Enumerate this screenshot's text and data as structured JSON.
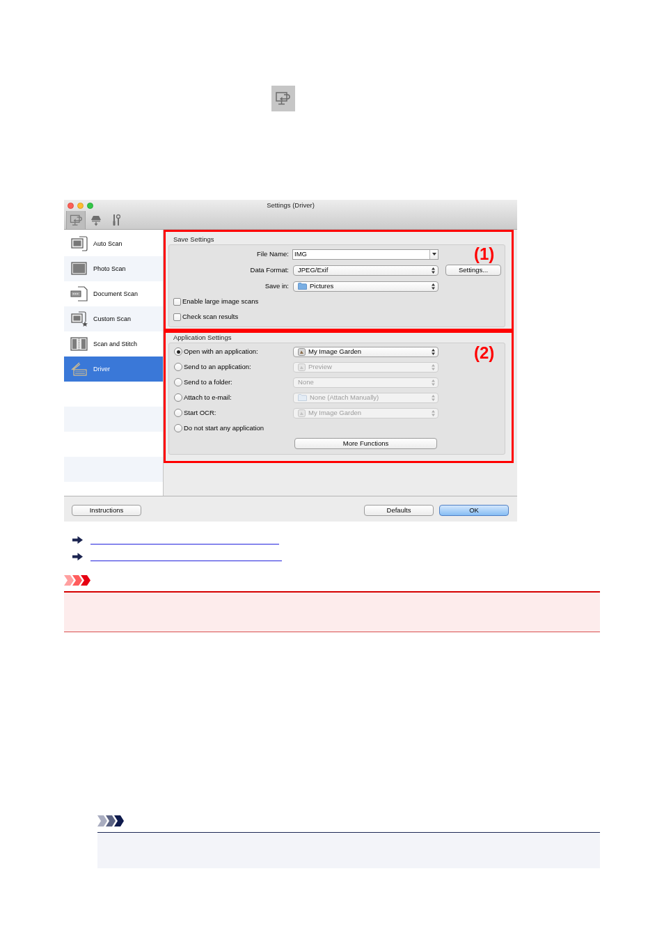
{
  "window": {
    "title": "Settings (Driver)"
  },
  "toolbar": [
    {
      "selected": true
    },
    {
      "selected": false
    },
    {
      "selected": false
    }
  ],
  "sidebar": {
    "items": [
      {
        "label": "Auto Scan",
        "selected": false
      },
      {
        "label": "Photo Scan",
        "selected": false
      },
      {
        "label": "Document Scan",
        "selected": false
      },
      {
        "label": "Custom Scan",
        "selected": false
      },
      {
        "label": "Scan and Stitch",
        "selected": false
      },
      {
        "label": "Driver",
        "selected": true
      }
    ]
  },
  "save_settings": {
    "title": "Save Settings",
    "callout": "(1)",
    "fields": [
      {
        "kind": "combo",
        "label": "File Name:",
        "value": "IMG"
      },
      {
        "kind": "popup",
        "label": "Data Format:",
        "value": "JPEG/Exif",
        "button": "Settings..."
      },
      {
        "kind": "folder",
        "label": "Save in:",
        "value": "Pictures"
      }
    ],
    "checkboxes": [
      {
        "label": "Enable large image scans",
        "checked": false
      },
      {
        "label": "Check scan results",
        "checked": false
      }
    ]
  },
  "application_settings": {
    "title": "Application Settings",
    "callout": "(2)",
    "options": [
      {
        "label": "Open with an application:",
        "selected": true,
        "dropdown": {
          "kind": "app",
          "value": "My Image Garden",
          "disabled": false
        }
      },
      {
        "label": "Send to an application:",
        "selected": false,
        "dropdown": {
          "kind": "app",
          "value": "Preview",
          "disabled": true
        }
      },
      {
        "label": "Send to a folder:",
        "selected": false,
        "dropdown": {
          "kind": "plain",
          "value": "None",
          "disabled": true
        }
      },
      {
        "label": "Attach to e-mail:",
        "selected": false,
        "dropdown": {
          "kind": "folder",
          "value": "None (Attach Manually)",
          "disabled": true
        }
      },
      {
        "label": "Start OCR:",
        "selected": false,
        "dropdown": {
          "kind": "app",
          "value": "My Image Garden",
          "disabled": true
        }
      },
      {
        "label": "Do not start any application",
        "selected": false
      }
    ],
    "button": "More Functions"
  },
  "footer": {
    "left_buttons": [
      {
        "label": "Instructions",
        "default": false
      }
    ],
    "right_buttons": [
      {
        "label": "Defaults",
        "default": false
      },
      {
        "label": "OK",
        "default": true
      }
    ]
  },
  "links": [
    {
      "kind": "arrow_link"
    },
    {
      "kind": "arrow_link"
    }
  ],
  "notices": [
    {
      "kind": "important"
    },
    {
      "kind": "note"
    }
  ]
}
